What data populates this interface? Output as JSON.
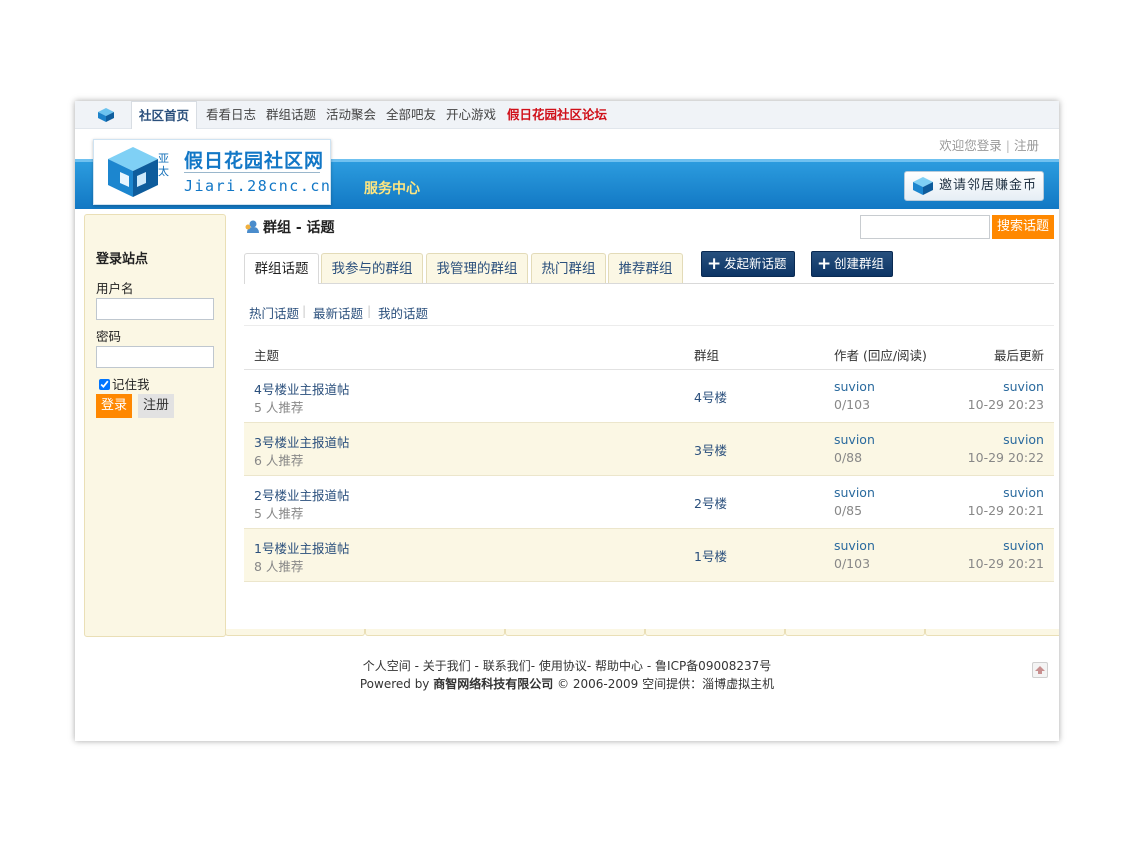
{
  "topnav": {
    "items": [
      "社区首页",
      "看看日志",
      "群组话题",
      "活动聚会",
      "全部吧友",
      "开心游戏",
      "假日花园社区论坛"
    ]
  },
  "header": {
    "welcome_login": "欢迎您登录",
    "welcome_sep": "|",
    "register": "注册",
    "logo_title": "假日花园社区网",
    "logo_sub": "Jiari.28cnc.cn",
    "logo_badge": "亚太",
    "service": "服务中心",
    "invite": "邀请邻居赚金币"
  },
  "sidebar": {
    "title": "登录站点",
    "username_label": "用户名",
    "password_label": "密码",
    "remember": "记住我",
    "login": "登录",
    "register": "注册"
  },
  "main": {
    "title": "群组 - 话题",
    "search_button": "搜索话题",
    "tabs": [
      "群组话题",
      "我参与的群组",
      "我管理的群组",
      "热门群组",
      "推荐群组"
    ],
    "new_topic": "发起新话题",
    "create_group": "创建群组",
    "subtabs": [
      "热门话题",
      "最新话题",
      "我的话题"
    ],
    "columns": {
      "topic": "主题",
      "group": "群组",
      "author": "作者 (回应/阅读)",
      "last": "最后更新"
    },
    "rows": [
      {
        "title": "4号楼业主报道帖",
        "rec": "5 人推荐",
        "group": "4号楼",
        "author": "suvion",
        "count": "0/103",
        "last_user": "suvion",
        "last_time": "10-29 20:23"
      },
      {
        "title": "3号楼业主报道帖",
        "rec": "6 人推荐",
        "group": "3号楼",
        "author": "suvion",
        "count": "0/88",
        "last_user": "suvion",
        "last_time": "10-29 20:22"
      },
      {
        "title": "2号楼业主报道帖",
        "rec": "5 人推荐",
        "group": "2号楼",
        "author": "suvion",
        "count": "0/85",
        "last_user": "suvion",
        "last_time": "10-29 20:21"
      },
      {
        "title": "1号楼业主报道帖",
        "rec": "8 人推荐",
        "group": "1号楼",
        "author": "suvion",
        "count": "0/103",
        "last_user": "suvion",
        "last_time": "10-29 20:21"
      }
    ]
  },
  "footer": {
    "links": [
      "个人空间",
      "关于我们",
      "联系我们",
      "使用协议",
      "帮助中心",
      "鲁ICP备09008237号"
    ],
    "powered_prefix": "Powered by ",
    "company": "商智网络科技有限公司",
    "copyright": " © 2006-2009 空间提供：",
    "host": "淄博虚拟主机"
  },
  "colors": {
    "accent_orange": "#ff8800",
    "brand_blue": "#1277c6",
    "highlight_red": "#d0101a",
    "panel_cream": "#fbf7e4"
  },
  "icons": {
    "logo": "cube-logo-icon",
    "title": "group-topic-icon",
    "totop": "back-to-top-icon"
  }
}
